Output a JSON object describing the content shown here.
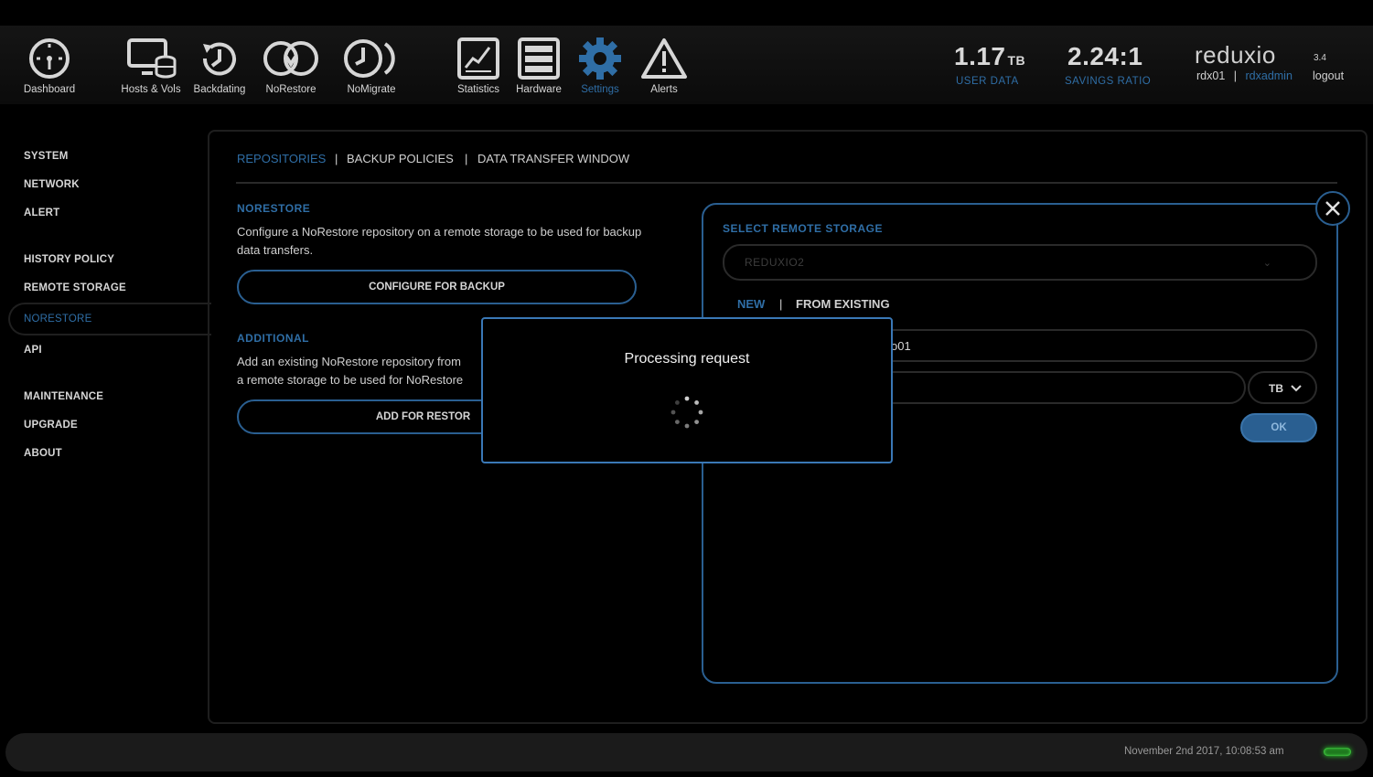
{
  "nav": {
    "items": [
      {
        "label": "Dashboard",
        "icon": "dashboard-gauge-icon"
      },
      {
        "label": "Hosts & Vols",
        "icon": "hosts-volumes-icon"
      },
      {
        "label": "Backdating",
        "icon": "backdating-clock-icon"
      },
      {
        "label": "NoRestore",
        "icon": "norestore-arrows-icon"
      },
      {
        "label": "NoMigrate",
        "icon": "nomigrate-icon"
      },
      {
        "label": "Statistics",
        "icon": "statistics-chart-icon"
      },
      {
        "label": "Hardware",
        "icon": "hardware-server-icon"
      },
      {
        "label": "Settings",
        "icon": "settings-gear-icon"
      },
      {
        "label": "Alerts",
        "icon": "alert-triangle-icon"
      }
    ],
    "active": "Settings"
  },
  "stats": {
    "user_data_value": "1.17",
    "user_data_unit": "TB",
    "user_data_label": "USER DATA",
    "savings_value": "2.24:1",
    "savings_label": "SAVINGS RATIO"
  },
  "brand": {
    "logo": "reduxio",
    "version": "3.4",
    "host": "rdx01",
    "host_sep": "|",
    "user": "rdxadmin",
    "logout": "logout"
  },
  "sidebar": {
    "items": [
      {
        "label": "SYSTEM"
      },
      {
        "label": "NETWORK"
      },
      {
        "label": "ALERT"
      },
      {
        "label": "HISTORY POLICY"
      },
      {
        "label": "REMOTE STORAGE"
      },
      {
        "label": "NORESTORE"
      },
      {
        "label": "API"
      },
      {
        "label": "MAINTENANCE"
      },
      {
        "label": "UPGRADE"
      },
      {
        "label": "ABOUT"
      }
    ],
    "active": "NORESTORE"
  },
  "tabs": {
    "repositories": "REPOSITORIES",
    "backup_policies": "BACKUP POLICIES",
    "data_transfer_window": "DATA TRANSFER WINDOW",
    "sep": "|"
  },
  "norestore": {
    "title": "NORESTORE",
    "text": "Configure a NoRestore repository on a remote storage to be used for backup data transfers.",
    "button": "CONFIGURE FOR BACKUP"
  },
  "additional": {
    "title": "ADDITIONAL",
    "text_line1": "Add an existing NoRestore repository from",
    "text_line2": "a remote storage to be used for NoRestore",
    "button": "ADD FOR RESTOR"
  },
  "remote_panel": {
    "title": "SELECT REMOTE STORAGE",
    "storage_value": "REDUXIO2",
    "tab_new": "NEW",
    "tab_sep": "|",
    "tab_existing": "FROM EXISTING",
    "repo_name_visible": "o01",
    "size_value": "",
    "unit_value": "TB",
    "ok": "OK"
  },
  "modal": {
    "title": "Processing request"
  },
  "footer": {
    "timestamp": "November 2nd 2017, 10:08:53 am",
    "status_color": "#2ad12a"
  },
  "colors": {
    "accent": "#2f6ea6",
    "border_accent": "#2a5f91",
    "background": "#000000"
  }
}
